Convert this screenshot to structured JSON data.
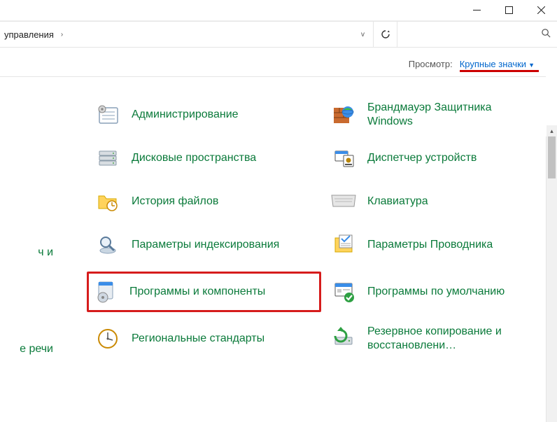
{
  "titlebar": {
    "minimize": "—",
    "maximize": "☐",
    "close": "✕"
  },
  "breadcrumb": {
    "text": "управления",
    "sep": "›"
  },
  "refresh_icon": "↻",
  "search": {
    "placeholder": ""
  },
  "view": {
    "label": "Просмотр:",
    "value": "Крупные значки"
  },
  "left_cut_items": [
    {
      "label": ""
    },
    {
      "label": ""
    },
    {
      "label": "ч и"
    },
    {
      "label": ""
    },
    {
      "label": ""
    },
    {
      "label": "е речи"
    }
  ],
  "items_col1": [
    {
      "label": "Администрирование",
      "icon": "admin"
    },
    {
      "label": "Дисковые пространства",
      "icon": "drives"
    },
    {
      "label": "История файлов",
      "icon": "folder-clock"
    },
    {
      "label": "Параметры индексирования",
      "icon": "magnify"
    },
    {
      "label": "Программы и компоненты",
      "icon": "programs",
      "highlighted": true
    },
    {
      "label": "Региональные стандарты",
      "icon": "region-clock"
    }
  ],
  "items_col2": [
    {
      "label": "Брандмауэр Защитника Windows",
      "icon": "firewall"
    },
    {
      "label": "Диспетчер устройств",
      "icon": "device-mgr"
    },
    {
      "label": "Клавиатура",
      "icon": "keyboard"
    },
    {
      "label": "Параметры Проводника",
      "icon": "explorer-opts"
    },
    {
      "label": "Программы по умолчанию",
      "icon": "defaults"
    },
    {
      "label": "Резервное копирование и восстановлени…",
      "icon": "backup"
    }
  ]
}
